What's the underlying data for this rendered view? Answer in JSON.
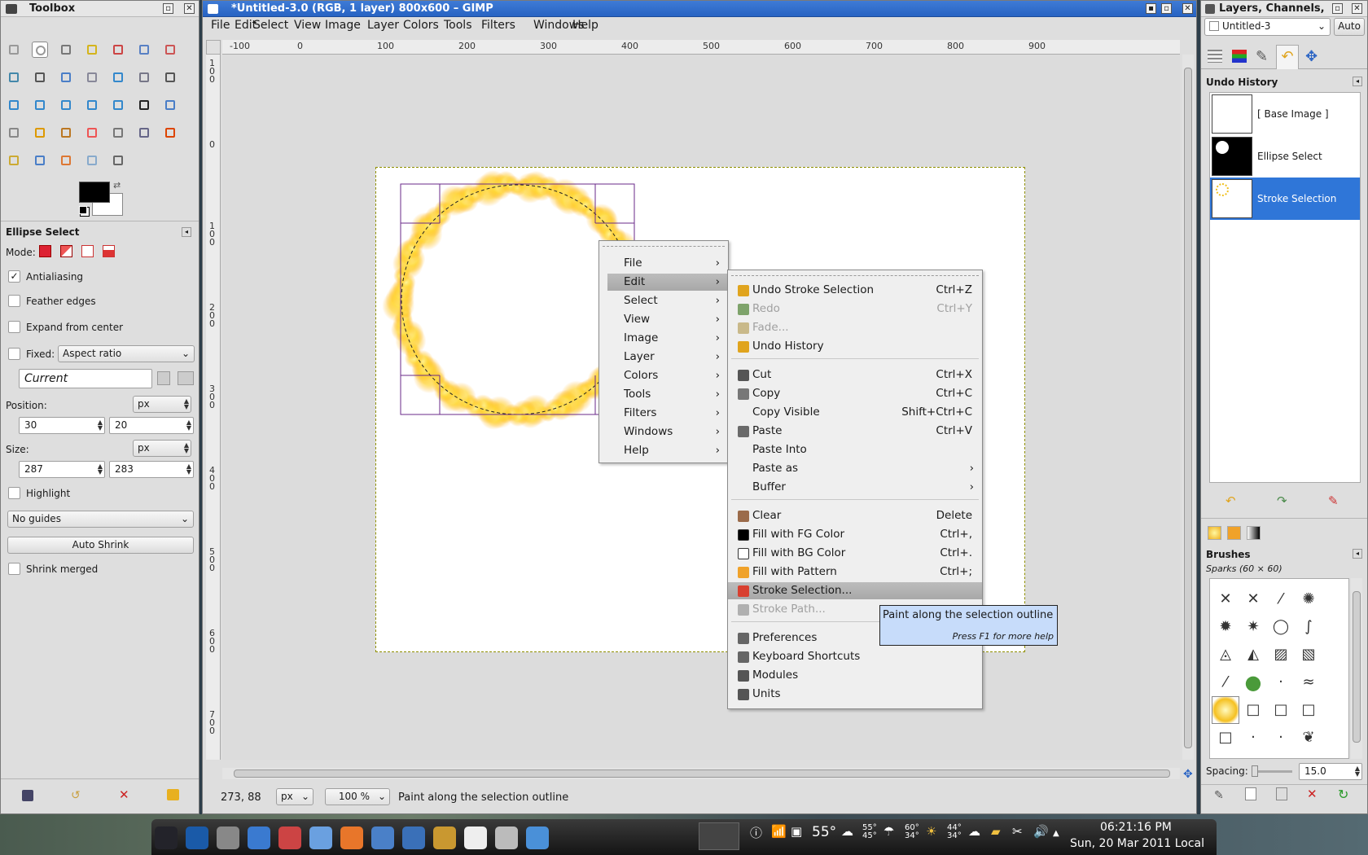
{
  "toolbox": {
    "title": "Toolbox"
  },
  "tool_options": {
    "title": "Ellipse Select",
    "mode_label": "Mode:",
    "antialiasing": "Antialiasing",
    "feather": "Feather edges",
    "expand": "Expand from center",
    "fixed": "Fixed:",
    "fixed_value": "Aspect ratio",
    "current": "Current",
    "position_label": "Position:",
    "position_unit": "px",
    "pos_x": "30",
    "pos_y": "20",
    "size_label": "Size:",
    "size_unit": "px",
    "size_w": "287",
    "size_h": "283",
    "highlight": "Highlight",
    "guides": "No guides",
    "auto_shrink": "Auto Shrink",
    "shrink_merged": "Shrink merged"
  },
  "image_window": {
    "title": "*Untitled-3.0 (RGB, 1 layer) 800x600 – GIMP",
    "menus": [
      "File",
      "Edit",
      "Select",
      "View",
      "Image",
      "Layer",
      "Colors",
      "Tools",
      "Filters",
      "Windows",
      "Help"
    ],
    "ruler_labels": [
      "-100",
      "0",
      "100",
      "200",
      "300",
      "400",
      "500",
      "600",
      "700",
      "800",
      "900"
    ],
    "vruler_labels": [
      "1 0 0",
      "0",
      "1 0 0",
      "2 0 0",
      "3 0 0",
      "4 0 0",
      "5 0 0",
      "6 0 0",
      "7 0 0"
    ],
    "coords": "273, 88",
    "unit": "px",
    "zoom": "100 %",
    "status": "Paint along the selection outline"
  },
  "context_menu": [
    "File",
    "Edit",
    "Select",
    "View",
    "Image",
    "Layer",
    "Colors",
    "Tools",
    "Filters",
    "Windows",
    "Help"
  ],
  "edit_menu": [
    {
      "label": "Undo Stroke Selection",
      "key": "Ctrl+Z",
      "disabled": false,
      "icon_color": "#e0a41e"
    },
    {
      "label": "Redo",
      "key": "Ctrl+Y",
      "disabled": true,
      "icon_color": "#7ea36b"
    },
    {
      "label": "Fade...",
      "key": "",
      "disabled": true,
      "icon_color": "#c9b98a"
    },
    {
      "label": "Undo History",
      "key": "",
      "disabled": false,
      "icon_color": "#e0a41e"
    },
    {
      "label": "Cut",
      "key": "Ctrl+X",
      "disabled": false,
      "icon_color": "#555555"
    },
    {
      "label": "Copy",
      "key": "Ctrl+C",
      "disabled": false,
      "icon_color": "#777777"
    },
    {
      "label": "Copy Visible",
      "key": "Shift+Ctrl+C",
      "disabled": false,
      "icon_color": ""
    },
    {
      "label": "Paste",
      "key": "Ctrl+V",
      "disabled": false,
      "icon_color": "#6a6a6a"
    },
    {
      "label": "Paste Into",
      "key": "",
      "disabled": false,
      "icon_color": ""
    },
    {
      "label": "Paste as",
      "key": "",
      "disabled": false,
      "icon_color": "",
      "submenu": true
    },
    {
      "label": "Buffer",
      "key": "",
      "disabled": false,
      "icon_color": "",
      "submenu": true
    },
    {
      "label": "Clear",
      "key": "Delete",
      "disabled": false,
      "icon_color": "#9b6b4a"
    },
    {
      "label": "Fill with FG Color",
      "key": "Ctrl+,",
      "disabled": false,
      "icon_color": "#000000"
    },
    {
      "label": "Fill with BG Color",
      "key": "Ctrl+.",
      "disabled": false,
      "icon_color": "#ffffff"
    },
    {
      "label": "Fill with Pattern",
      "key": "Ctrl+;",
      "disabled": false,
      "icon_color": "#f0a22a"
    },
    {
      "label": "Stroke Selection...",
      "key": "",
      "disabled": false,
      "icon_color": "#d84030",
      "highlight": true
    },
    {
      "label": "Stroke Path...",
      "key": "",
      "disabled": true,
      "icon_color": "#b0b0b0"
    },
    {
      "label": "Preferences",
      "key": "",
      "disabled": false,
      "icon_color": "#666666"
    },
    {
      "label": "Keyboard Shortcuts",
      "key": "",
      "disabled": false,
      "icon_color": "#666666"
    },
    {
      "label": "Modules",
      "key": "",
      "disabled": false,
      "icon_color": "#555555"
    },
    {
      "label": "Units",
      "key": "",
      "disabled": false,
      "icon_color": "#555555"
    }
  ],
  "tooltip": {
    "text": "Paint along the selection outline",
    "help": "Press F1 for more help"
  },
  "dock": {
    "title": "Layers, Channels,",
    "image": "Untitled-3",
    "auto": "Auto",
    "undo_title": "Undo History",
    "history": [
      "[ Base Image ]",
      "Ellipse Select",
      "Stroke Selection"
    ],
    "brushes_title": "Brushes",
    "brush_name": "Sparks (60 × 60)",
    "spacing_label": "Spacing:",
    "spacing_value": "15.0"
  },
  "taskbar": {
    "time": "06:21:16 PM",
    "date": "Sun, 20 Mar 2011 Local",
    "temps": [
      "55°",
      "55° 45°",
      "60° 34°",
      "44° 34°"
    ]
  },
  "colors": {
    "selection": "#2763c3",
    "menu_hl": "#b0b0b0",
    "tooltip_bg": "#c7dcfa",
    "fg": "#000000",
    "bg": "#ffffff"
  }
}
